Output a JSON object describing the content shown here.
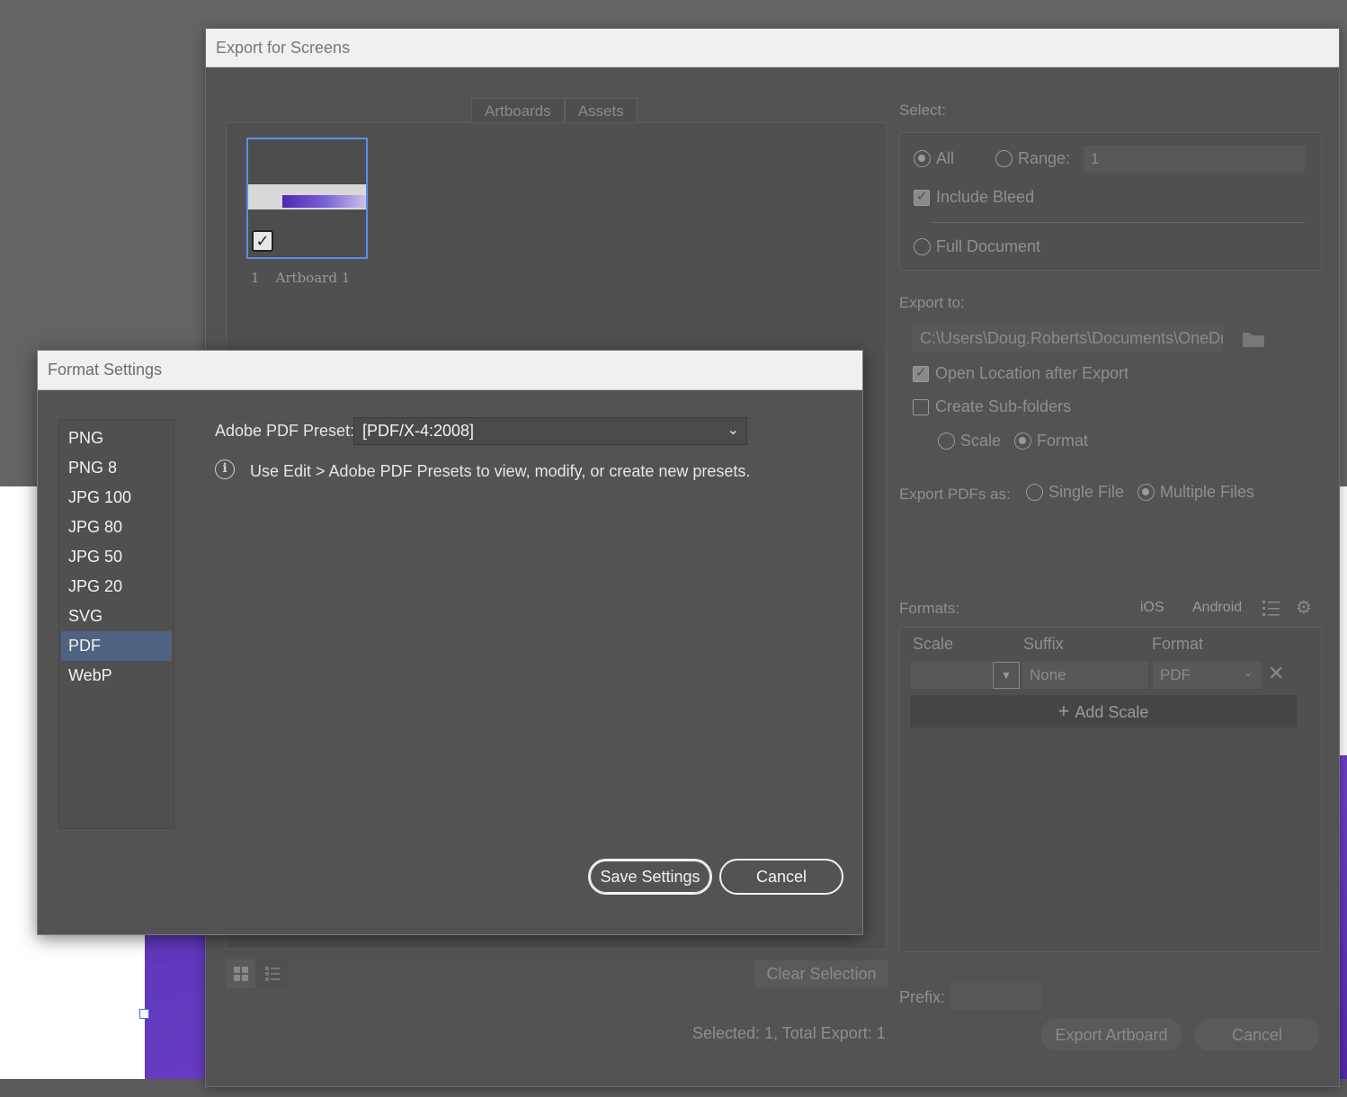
{
  "main_dialog": {
    "title": "Export for Screens",
    "tabs": [
      "Artboards",
      "Assets"
    ],
    "artboard": {
      "index": "1",
      "name": "Artboard 1",
      "checked": true
    },
    "select_label": "Select:",
    "all_label": "All",
    "range_label": "Range:",
    "range_value": "1",
    "include_bleed_label": "Include Bleed",
    "full_document_label": "Full Document",
    "export_to_label": "Export to:",
    "export_path": "C:\\Users\\Doug.Roberts\\Documents\\OneDr",
    "open_location_label": "Open Location after Export",
    "create_subfolders_label": "Create Sub-folders",
    "scale_label": "Scale",
    "format_label": "Format",
    "export_pdfs_label": "Export PDFs as:",
    "single_file_label": "Single File",
    "multiple_files_label": "Multiple Files",
    "formats_label": "Formats:",
    "ios_label": "iOS",
    "android_label": "Android",
    "col_scale": "Scale",
    "col_suffix": "Suffix",
    "col_format": "Format",
    "suffix_placeholder": "None",
    "format_value": "PDF",
    "add_scale_label": "Add Scale",
    "clear_selection_label": "Clear Selection",
    "prefix_label": "Prefix:",
    "status_text": "Selected: 1, Total Export: 1",
    "export_button": "Export Artboard",
    "cancel_button": "Cancel"
  },
  "format_settings": {
    "title": "Format Settings",
    "formats": [
      "PNG",
      "PNG 8",
      "JPG 100",
      "JPG 80",
      "JPG 50",
      "JPG 20",
      "SVG",
      "PDF",
      "WebP"
    ],
    "selected_format": "PDF",
    "preset_label": "Adobe PDF Preset:",
    "preset_value": "[PDF/X-4:2008]",
    "info_text": "Use Edit > Adobe PDF Presets to view, modify, or create new presets.",
    "save_button": "Save Settings",
    "cancel_button": "Cancel"
  },
  "colors": {
    "selection_blue": "#4e6282",
    "artboard_border": "#5c8ee6",
    "canvas_purple": "#5a33b8"
  }
}
